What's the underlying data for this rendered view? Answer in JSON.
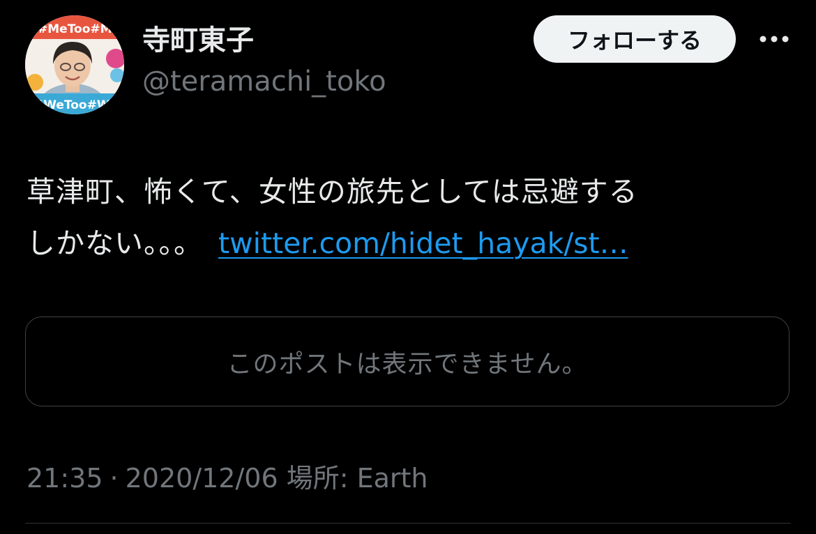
{
  "author": {
    "display_name": "寺町東子",
    "handle": "@teramachi_toko",
    "avatar_banner_text": "#MeToo#WeToo"
  },
  "header": {
    "follow_label": "フォローする",
    "more_icon": "more-dots-icon"
  },
  "tweet": {
    "text_line1": "草津町、怖くて、女性の旅先としては忌避する",
    "text_line2": "しかない。。。",
    "link_text": "twitter.com/hidet_hayak/st…"
  },
  "quoted_post": {
    "unavailable_text": "このポストは表示できません。"
  },
  "meta": {
    "time": "21:35",
    "separator": "·",
    "date": "2020/12/06",
    "location_label": "場所: Earth"
  },
  "colors": {
    "background": "#000000",
    "text": "#e7e9ea",
    "muted": "#71767b",
    "link": "#1d9bf0",
    "button_bg": "#eff3f4",
    "border": "#3e4144"
  }
}
